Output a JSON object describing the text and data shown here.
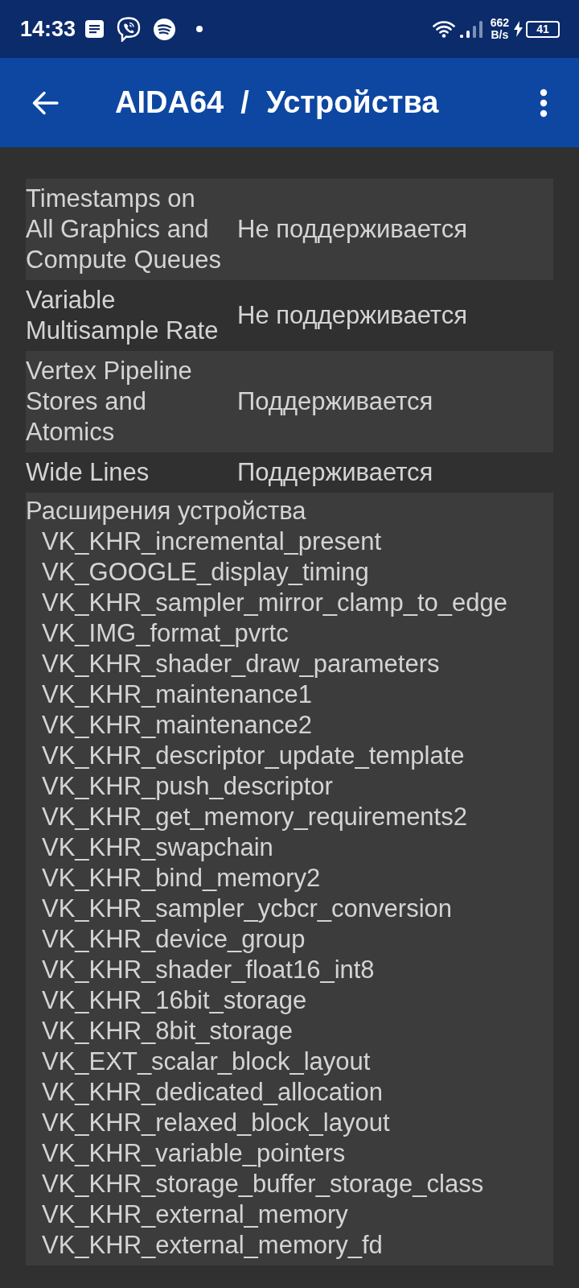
{
  "status_bar": {
    "time": "14:33",
    "net_speed": "662",
    "net_unit": "B/s",
    "battery": "41"
  },
  "app_bar": {
    "title": "AIDA64  /  Устройства"
  },
  "properties": [
    {
      "name": "Timestamps on All Graphics and Compute Queues",
      "value": "Не поддерживается"
    },
    {
      "name": "Variable Multisample Rate",
      "value": "Не поддерживается"
    },
    {
      "name": "Vertex Pipeline Stores and Atomics",
      "value": "Поддерживается"
    },
    {
      "name": "Wide Lines",
      "value": "Поддерживается"
    }
  ],
  "extensions": {
    "title": "Расширения устройства",
    "items": [
      "VK_KHR_incremental_present",
      "VK_GOOGLE_display_timing",
      "VK_KHR_sampler_mirror_clamp_to_edge",
      "VK_IMG_format_pvrtc",
      "VK_KHR_shader_draw_parameters",
      "VK_KHR_maintenance1",
      "VK_KHR_maintenance2",
      "VK_KHR_descriptor_update_template",
      "VK_KHR_push_descriptor",
      "VK_KHR_get_memory_requirements2",
      "VK_KHR_swapchain",
      "VK_KHR_bind_memory2",
      "VK_KHR_sampler_ycbcr_conversion",
      "VK_KHR_device_group",
      "VK_KHR_shader_float16_int8",
      "VK_KHR_16bit_storage",
      "VK_KHR_8bit_storage",
      "VK_EXT_scalar_block_layout",
      "VK_KHR_dedicated_allocation",
      "VK_KHR_relaxed_block_layout",
      "VK_KHR_variable_pointers",
      "VK_KHR_storage_buffer_storage_class",
      "VK_KHR_external_memory",
      "VK_KHR_external_memory_fd"
    ]
  }
}
